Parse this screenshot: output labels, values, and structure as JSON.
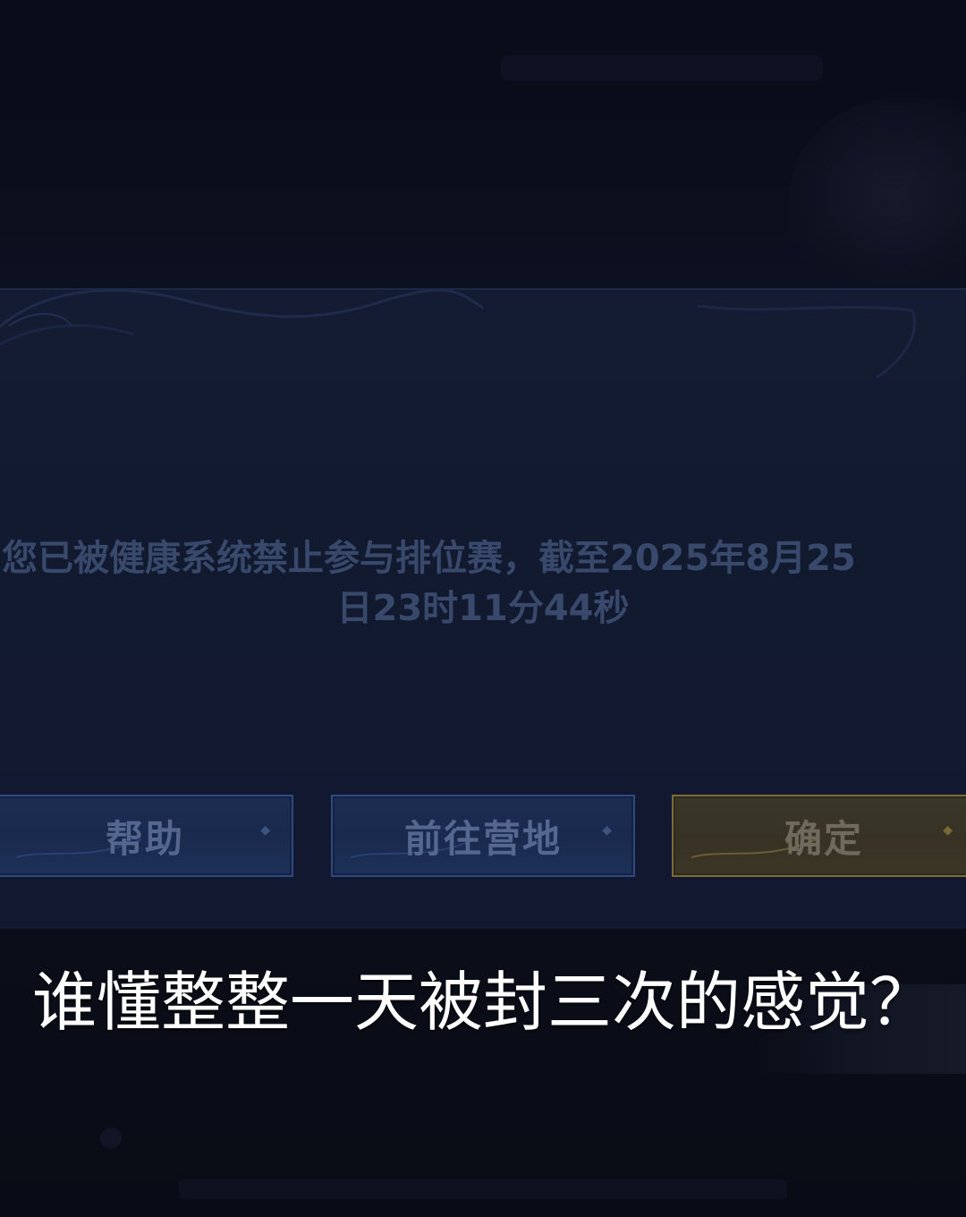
{
  "dialog": {
    "message_line1": "您已被健康系统禁止参与排位赛，截至2025年8月25",
    "message_line2": "日23时11分44秒",
    "buttons": {
      "help": "帮助",
      "go_camp": "前往营地",
      "confirm": "确定"
    }
  },
  "caption": {
    "text": "谁懂整整一天被封三次的感觉？"
  },
  "colors": {
    "background": "#080a16",
    "dialog_panel": "#131b32",
    "message_text": "#39496c",
    "button_blue_border": "#2c4a80",
    "button_gold_border": "#7d6a35",
    "caption_text": "#ffffff"
  }
}
